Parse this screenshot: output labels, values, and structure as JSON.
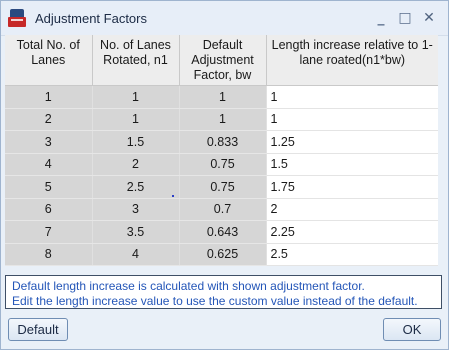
{
  "window": {
    "title": "Adjustment Factors",
    "icon": "app-logo-icon",
    "controls": {
      "minimize": "_",
      "maximize": "□",
      "close": "✕"
    }
  },
  "table": {
    "headers": [
      "Total No. of Lanes",
      "No. of Lanes Rotated, n1",
      "Default Adjustment Factor, bw",
      "Length increase relative to 1-lane roated(n1*bw)"
    ],
    "rows": [
      [
        "1",
        "1",
        "1",
        "1"
      ],
      [
        "2",
        "1",
        "1",
        "1"
      ],
      [
        "3",
        "1.5",
        "0.833",
        "1.25"
      ],
      [
        "4",
        "2",
        "0.75",
        "1.5"
      ],
      [
        "5",
        "2.5",
        "0.75",
        "1.75"
      ],
      [
        "6",
        "3",
        "0.7",
        "2"
      ],
      [
        "7",
        "3.5",
        "0.643",
        "2.25"
      ],
      [
        "8",
        "4",
        "0.625",
        "2.5"
      ]
    ]
  },
  "info": {
    "line1": "Default length increase is calculated with shown adjustment factor.",
    "line2": "Edit the length increase value to use the custom value instead of the default."
  },
  "buttons": {
    "default_label": "Default",
    "ok_label": "OK"
  }
}
